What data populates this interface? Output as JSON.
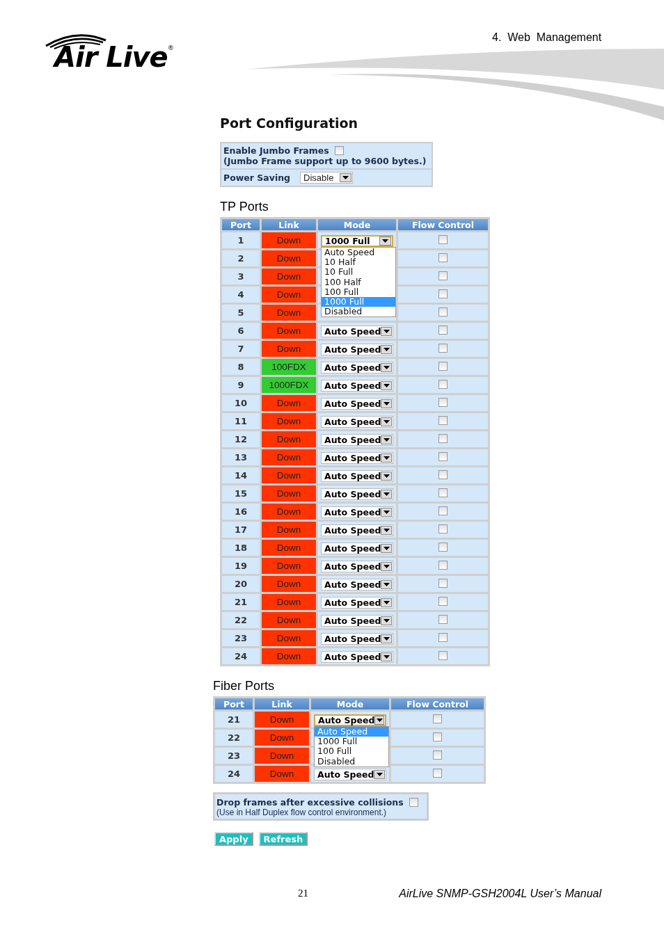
{
  "header": {
    "logo": "Air Live",
    "logo_mark": "®",
    "section": "4.  Web  Management"
  },
  "title": "Port Configuration",
  "settings": {
    "jumbo_label": "Enable Jumbo Frames",
    "jumbo_checked": false,
    "jumbo_note": "(Jumbo Frame support up to 9600 bytes.)",
    "power_label": "Power Saving",
    "power_value": "Disable"
  },
  "tp_ports": {
    "title": "TP Ports",
    "columns": [
      "Port",
      "Link",
      "Mode",
      "Flow Control"
    ],
    "rows": [
      {
        "port": "1",
        "link": "Down",
        "color": "#ff3300",
        "mode": "1000 Full",
        "flow_control": false,
        "dropdown": [
          {
            "label": "Auto Speed",
            "selected": false
          },
          {
            "label": "10 Half",
            "selected": false
          },
          {
            "label": "10 Full",
            "selected": false
          },
          {
            "label": "100 Half",
            "selected": false
          },
          {
            "label": "100 Full",
            "selected": false
          },
          {
            "label": "1000 Full",
            "selected": true
          },
          {
            "label": "Disabled",
            "selected": false
          }
        ]
      },
      {
        "port": "2",
        "link": "Down",
        "color": "#ff3300",
        "flow_control": false
      },
      {
        "port": "3",
        "link": "Down",
        "color": "#ff3300",
        "flow_control": false
      },
      {
        "port": "4",
        "link": "Down",
        "color": "#ff3300",
        "flow_control": false
      },
      {
        "port": "5",
        "link": "Down",
        "color": "#ff3300",
        "flow_control": false
      },
      {
        "port": "6",
        "link": "Down",
        "color": "#ff3300",
        "mode": "Auto Speed",
        "flow_control": false
      },
      {
        "port": "7",
        "link": "Down",
        "color": "#ff3300",
        "mode": "Auto Speed",
        "flow_control": false
      },
      {
        "port": "8",
        "link": "100FDX",
        "color": "#33cc33",
        "mode": "Auto Speed",
        "flow_control": false
      },
      {
        "port": "9",
        "link": "1000FDX",
        "color": "#33cc33",
        "mode": "Auto Speed",
        "flow_control": false
      },
      {
        "port": "10",
        "link": "Down",
        "color": "#ff3300",
        "mode": "Auto Speed",
        "flow_control": false
      },
      {
        "port": "11",
        "link": "Down",
        "color": "#ff3300",
        "mode": "Auto Speed",
        "flow_control": false
      },
      {
        "port": "12",
        "link": "Down",
        "color": "#ff3300",
        "mode": "Auto Speed",
        "flow_control": false
      },
      {
        "port": "13",
        "link": "Down",
        "color": "#ff3300",
        "mode": "Auto Speed",
        "flow_control": false
      },
      {
        "port": "14",
        "link": "Down",
        "color": "#ff3300",
        "mode": "Auto Speed",
        "flow_control": false
      },
      {
        "port": "15",
        "link": "Down",
        "color": "#ff3300",
        "mode": "Auto Speed",
        "flow_control": false
      },
      {
        "port": "16",
        "link": "Down",
        "color": "#ff3300",
        "mode": "Auto Speed",
        "flow_control": false
      },
      {
        "port": "17",
        "link": "Down",
        "color": "#ff3300",
        "mode": "Auto Speed",
        "flow_control": false
      },
      {
        "port": "18",
        "link": "Down",
        "color": "#ff3300",
        "mode": "Auto Speed",
        "flow_control": false
      },
      {
        "port": "19",
        "link": "Down",
        "color": "#ff3300",
        "mode": "Auto Speed",
        "flow_control": false
      },
      {
        "port": "20",
        "link": "Down",
        "color": "#ff3300",
        "mode": "Auto Speed",
        "flow_control": false
      },
      {
        "port": "21",
        "link": "Down",
        "color": "#ff3300",
        "mode": "Auto Speed",
        "flow_control": false
      },
      {
        "port": "22",
        "link": "Down",
        "color": "#ff3300",
        "mode": "Auto Speed",
        "flow_control": false
      },
      {
        "port": "23",
        "link": "Down",
        "color": "#ff3300",
        "mode": "Auto Speed",
        "flow_control": false
      },
      {
        "port": "24",
        "link": "Down",
        "color": "#ff3300",
        "mode": "Auto Speed",
        "flow_control": false
      }
    ]
  },
  "fiber_ports": {
    "title": "Fiber Ports",
    "columns": [
      "Port",
      "Link",
      "Mode",
      "Flow Control"
    ],
    "rows": [
      {
        "port": "21",
        "link": "Down",
        "color": "#ff3300",
        "mode": "Auto Speed",
        "flow_control": false,
        "dropdown": [
          {
            "label": "Auto Speed",
            "selected": true
          },
          {
            "label": "1000 Full",
            "selected": false
          },
          {
            "label": "100 Full",
            "selected": false
          },
          {
            "label": "Disabled",
            "selected": false
          }
        ]
      },
      {
        "port": "22",
        "link": "Down",
        "color": "#ff3300",
        "flow_control": false
      },
      {
        "port": "23",
        "link": "Down",
        "color": "#ff3300",
        "flow_control": false
      },
      {
        "port": "24",
        "link": "Down",
        "color": "#ff3300",
        "mode": "Auto Speed",
        "flow_control": false
      }
    ]
  },
  "collisions": {
    "label": "Drop frames after excessive collisions",
    "checked": false,
    "note": "(Use in Half Duplex flow control environment.)"
  },
  "buttons": [
    "Apply",
    "Refresh"
  ],
  "footer": {
    "page": "21",
    "manual": "AirLive SNMP-GSH2004L User’s Manual"
  }
}
